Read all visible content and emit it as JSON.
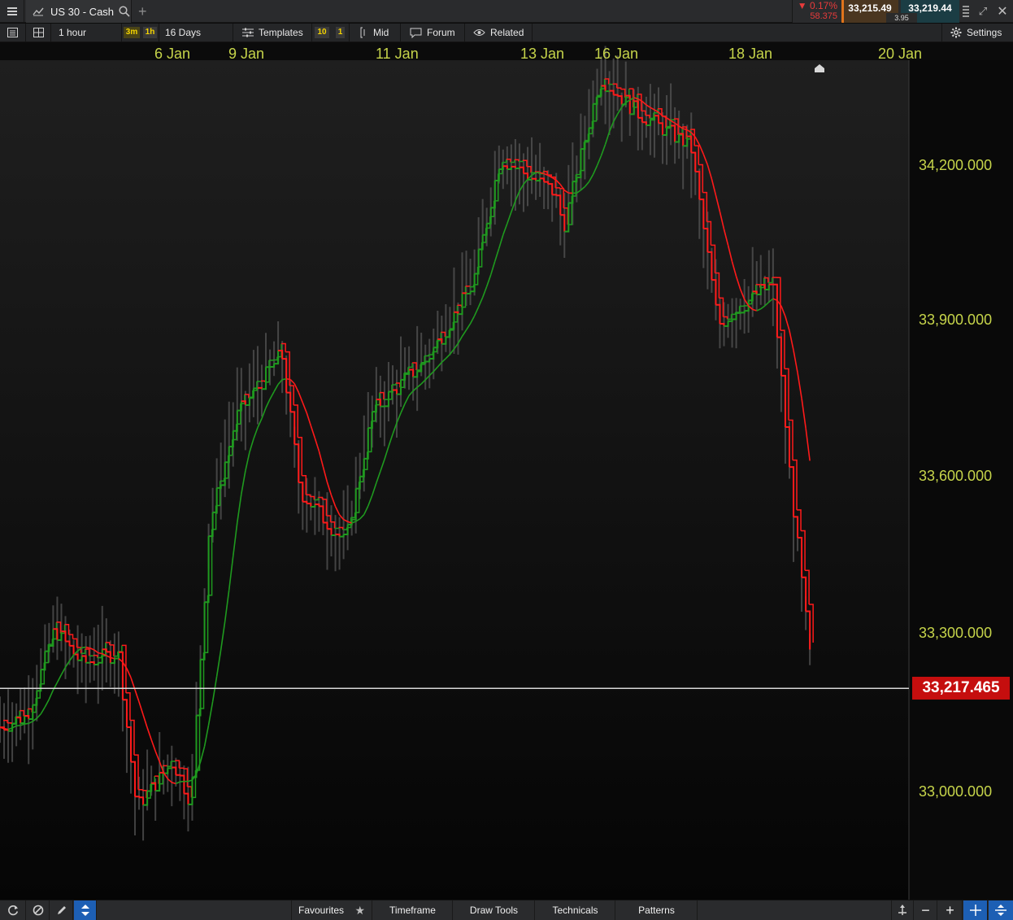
{
  "window": {
    "tab_title": "US 30 - Cash",
    "new_tab": "+",
    "change_percent": "▼ 0.17%",
    "change_points": "58.375",
    "sell_price": "33,215.49",
    "spread": "3.95",
    "buy_price": "33,219.44"
  },
  "toolbar": {
    "interval": "1 hour",
    "tf_badge_1": "3m",
    "tf_badge_2": "1h",
    "period": "16 Days",
    "templates": "Templates",
    "badge_10": "10",
    "badge_1": "1",
    "mid": "Mid",
    "forum": "Forum",
    "related": "Related",
    "settings": "Settings"
  },
  "chart": {
    "last_price": "33,217.465",
    "colors": {
      "up": "#1f9a1f",
      "down": "#ff1a1a",
      "wick": "#5a5a5a",
      "axis_text": "#c6d44a",
      "last_price_bg": "#c50e0e"
    }
  },
  "chart_data": {
    "type": "line",
    "instrument": "US 30 - Cash",
    "interval": "1 hour",
    "period": "16 Days",
    "x_tick_labels": [
      "6 Jan",
      "9 Jan",
      "11 Jan",
      "13 Jan",
      "16 Jan",
      "18 Jan",
      "20 Jan"
    ],
    "y_tick_labels": [
      "34,200.000",
      "33,900.000",
      "33,600.000",
      "33,300.000",
      "33,000.000"
    ],
    "y_ticks": [
      34200,
      33900,
      33600,
      33300,
      33000
    ],
    "ylim": [
      32850,
      34310
    ],
    "last_price": 33217.465,
    "price_path": [
      {
        "x": 0.0,
        "y": 33150
      },
      {
        "x": 0.03,
        "y": 33170
      },
      {
        "x": 0.06,
        "y": 33320
      },
      {
        "x": 0.09,
        "y": 33260
      },
      {
        "x": 0.13,
        "y": 33280
      },
      {
        "x": 0.15,
        "y": 33010
      },
      {
        "x": 0.19,
        "y": 33090
      },
      {
        "x": 0.21,
        "y": 33020
      },
      {
        "x": 0.23,
        "y": 33500
      },
      {
        "x": 0.26,
        "y": 33690
      },
      {
        "x": 0.31,
        "y": 33800
      },
      {
        "x": 0.33,
        "y": 33560
      },
      {
        "x": 0.38,
        "y": 33470
      },
      {
        "x": 0.41,
        "y": 33700
      },
      {
        "x": 0.47,
        "y": 33790
      },
      {
        "x": 0.52,
        "y": 33920
      },
      {
        "x": 0.55,
        "y": 34140
      },
      {
        "x": 0.61,
        "y": 34080
      },
      {
        "x": 0.62,
        "y": 34020
      },
      {
        "x": 0.66,
        "y": 34280
      },
      {
        "x": 0.7,
        "y": 34220
      },
      {
        "x": 0.76,
        "y": 34160
      },
      {
        "x": 0.79,
        "y": 33850
      },
      {
        "x": 0.83,
        "y": 33900
      },
      {
        "x": 0.85,
        "y": 33920
      },
      {
        "x": 0.87,
        "y": 33570
      },
      {
        "x": 0.895,
        "y": 33220
      }
    ],
    "series": [
      {
        "values": [
          33250,
          33280,
          33150,
          33020,
          33130,
          33520,
          33730,
          33540,
          33480,
          33600,
          33760,
          33880,
          34060,
          34110,
          34220,
          34210,
          34180,
          33900,
          33890,
          33420
        ]
      }
    ]
  },
  "bottombar": {
    "favourites": "Favourites",
    "timeframe": "Timeframe",
    "draw_tools": "Draw Tools",
    "technicals": "Technicals",
    "patterns": "Patterns",
    "zoom_out": "−",
    "zoom_in": "+"
  }
}
